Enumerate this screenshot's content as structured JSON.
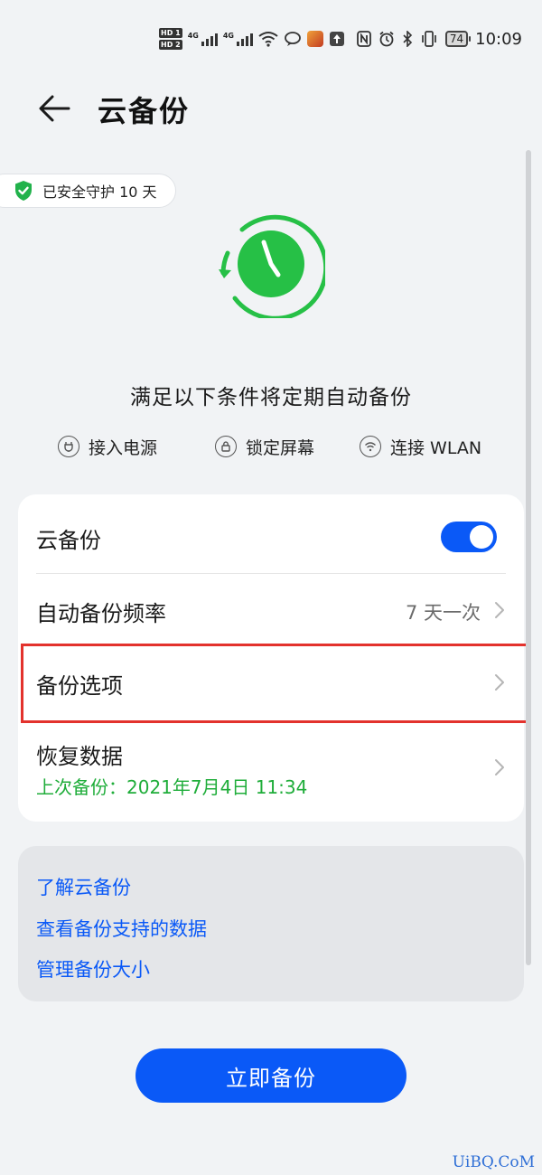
{
  "status_bar": {
    "hd1": "HD 1",
    "hd2": "HD 2",
    "net1": "4G",
    "net2": "4G",
    "battery": "74",
    "time": "10:09"
  },
  "header": {
    "title": "云备份"
  },
  "protect_badge": {
    "text": "已安全守护 10 天"
  },
  "hero": {
    "subtitle": "满足以下条件将定期自动备份"
  },
  "conditions": [
    {
      "label": "接入电源",
      "icon": "power-plug-icon"
    },
    {
      "label": "锁定屏幕",
      "icon": "lock-icon"
    },
    {
      "label": "连接 WLAN",
      "icon": "wifi-icon"
    }
  ],
  "settings": {
    "cloud_backup": {
      "label": "云备份",
      "toggle_on": true
    },
    "frequency": {
      "label": "自动备份频率",
      "value": "7 天一次"
    },
    "options": {
      "label": "备份选项"
    },
    "restore": {
      "label": "恢复数据",
      "sub": "上次备份：2021年7月4日 11:34"
    }
  },
  "links": [
    "了解云备份",
    "查看备份支持的数据",
    "管理备份大小"
  ],
  "primary_button": {
    "label": "立即备份"
  },
  "watermark": "UiBQ.CoM",
  "colors": {
    "accent": "#0a59f7",
    "success": "#1fad3a",
    "highlight": "#e3322d",
    "background": "#f1f3f5"
  }
}
